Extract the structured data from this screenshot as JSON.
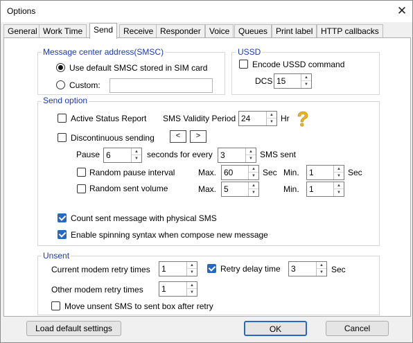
{
  "window": {
    "title": "Options",
    "close_glyph": "✕"
  },
  "tabs": [
    {
      "label": "General"
    },
    {
      "label": "Work Time"
    },
    {
      "label": "Send",
      "active": true
    },
    {
      "label": "Receive"
    },
    {
      "label": "Responder"
    },
    {
      "label": "Voice"
    },
    {
      "label": "Queues"
    },
    {
      "label": "Print label"
    },
    {
      "label": "HTTP callbacks"
    }
  ],
  "smsc": {
    "group_label": "Message center address(SMSC)",
    "default_option": "Use default SMSC stored in SIM card",
    "default_selected": true,
    "custom_option": "Custom:",
    "custom_value": ""
  },
  "ussd": {
    "group_label": "USSD",
    "encode_label": "Encode USSD command",
    "encode_checked": false,
    "dcs_label": "DCS",
    "dcs_value": "15"
  },
  "send_option": {
    "group_label": "Send option",
    "active_status_label": "Active Status Report",
    "active_status_checked": false,
    "validity_label": "SMS Validity Period",
    "validity_value": "24",
    "validity_unit": "Hr",
    "help_icon": "question-mark-icon",
    "discontinuous_label": "Discontinuous sending",
    "discontinuous_checked": false,
    "prev_glyph": "<",
    "next_glyph": ">",
    "pause_label": "Pause",
    "pause_value": "6",
    "seconds_every_label": "seconds for every",
    "every_value": "3",
    "sms_sent_label": "SMS sent",
    "random_pause_label": "Random pause interval",
    "random_pause_checked": false,
    "random_volume_label": "Random sent volume",
    "random_volume_checked": false,
    "max_label": "Max.",
    "min_label": "Min.",
    "sec_label": "Sec",
    "pause_max": "60",
    "pause_min": "1",
    "volume_max": "5",
    "volume_min": "1",
    "count_physical_label": "Count sent message with physical SMS",
    "count_physical_checked": true,
    "spinning_label": "Enable spinning syntax when compose new message",
    "spinning_checked": true
  },
  "unsent": {
    "group_label": "Unsent",
    "current_retry_label": "Current modem retry times",
    "current_retry_value": "1",
    "retry_delay_label": "Retry delay time",
    "retry_delay_checked": true,
    "retry_delay_value": "3",
    "sec_label": "Sec",
    "other_retry_label": "Other modem retry times",
    "other_retry_value": "1",
    "move_unsent_label": "Move unsent SMS to sent box after retry",
    "move_unsent_checked": false
  },
  "footer": {
    "load_default": "Load default settings",
    "ok": "OK",
    "cancel": "Cancel"
  },
  "colors": {
    "accent": "#2667c0",
    "group_label": "#1c3aa9",
    "help_icon": "#e8b31d"
  }
}
